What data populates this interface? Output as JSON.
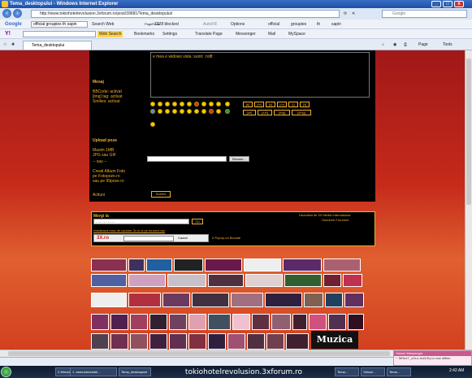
{
  "window": {
    "title": "Tema_desktopului - Windows Internet Explorer",
    "min": "_",
    "max": "□",
    "close": "x"
  },
  "address": {
    "url": "http://www.tokiohotelrevolusion.3xforum.ro/post/39681/Tema_desktopului/",
    "search_placeholder": "Google"
  },
  "google_toolbar": {
    "logo": "Google",
    "search_value": "official groupies th sapin",
    "buttons": [
      "Search Web",
      "7328 blocked",
      "AutoFill",
      "Options",
      "official",
      "groupies",
      "th",
      "sapin"
    ],
    "pagerank_label": "PageRank"
  },
  "yahoo_toolbar": {
    "logo": "Y!",
    "search_label": "Web Search",
    "buttons": [
      "Bookmarks",
      "Settings",
      "Translate Page",
      "Messenger",
      "Mail",
      "MySpace"
    ]
  },
  "tab": {
    "label": "Tema_desktopului"
  },
  "command_bar": {
    "page": "Page",
    "tools": "Tools"
  },
  "form": {
    "textarea_text": "e mea e widows vista :sunit:  :rotfl:",
    "mesaj_label": "Mesaj",
    "bbcode": "BBCode: activat",
    "img_tag": "[img] tag: activat",
    "smilies": "Smilies: activat",
    "bb_buttons": [
      "[b]",
      "[/b]",
      "[u]",
      "[/u]",
      "[i]",
      "[/i]",
      "[url]",
      "[/url]",
      "[img]",
      "[/img]"
    ],
    "upload_label": "Upload poza",
    "upload_info": [
      "Maxim 1MB",
      "JPG sau GIF",
      "",
      "-- sau --",
      "",
      "Creati Album Foto",
      "pe Fotopoze.ro",
      "sau pe 99poze.ro"
    ],
    "browse_label": "Browse...",
    "actiuni_label": "Actiuni",
    "submit_label": "Submit"
  },
  "search_panel": {
    "mergi_label": "Mergi la",
    "select_placeholder": "- - - - - - - - - -",
    "go_label": "Go",
    "credit_line1": "Dezvoltat de 3X Media International",
    "credit_line2": "Gazduire Forumuri",
    "instaleaza": "Instaleaza bara de cautare 3x.ro si pe forumul tau",
    "logo": "3X.ro",
    "cauta": "Cauta!",
    "popup": "0 Popup-uri Blocate"
  },
  "muzica_label": "Muzica",
  "notification": {
    "title": "Yahoo! Messenger",
    "text": "~ StReeT_sOuL AnDrEy is now offline"
  },
  "taskbar": {
    "items": [
      "2 Windows...",
      "1. www.tokiohotel...",
      "Tema_desktopului",
      "Tema...",
      "Yahoo!...",
      "Tema..."
    ],
    "clock": "2:42 AM"
  },
  "caption": "tokiohotelrevolusion.3xforum.ro",
  "colors": {
    "accent": "#f0b030",
    "page_bg": "#c22",
    "form_bg": "#000000"
  }
}
